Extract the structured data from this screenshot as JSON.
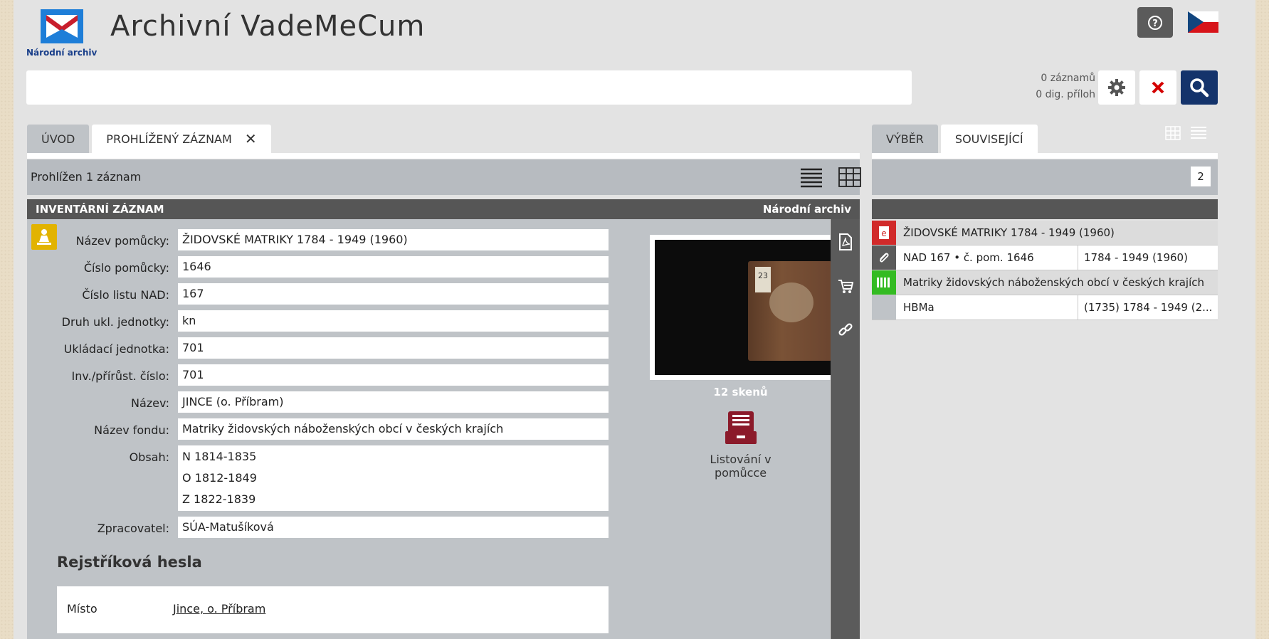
{
  "header": {
    "logo_text": "Národní archiv",
    "app_title": "Archivní VadeMeCum"
  },
  "search": {
    "records_count": "0 záznamů",
    "digital_count": "0 dig. příloh"
  },
  "left_tabs": [
    {
      "label": "ÚVOD"
    },
    {
      "label": "PROHLÍŽENÝ ZÁZNAM"
    }
  ],
  "right_tabs": [
    {
      "label": "VÝBĚR"
    },
    {
      "label": "SOUVISEJÍCÍ"
    }
  ],
  "left_panel": {
    "status": "Prohlížen 1 záznam"
  },
  "record": {
    "type_label": "INVENTÁRNÍ ZÁZNAM",
    "archive_label": "Národní archiv",
    "fields": [
      {
        "label": "Název pomůcky:",
        "value": "ŽIDOVSKÉ MATRIKY 1784 - 1949 (1960)"
      },
      {
        "label": "Číslo pomůcky:",
        "value": "1646"
      },
      {
        "label": "Číslo listu NAD:",
        "value": "167"
      },
      {
        "label": "Druh ukl. jednotky:",
        "value": "kn"
      },
      {
        "label": "Ukládací jednotka:",
        "value": "701"
      },
      {
        "label": "Inv./přírůst. číslo:",
        "value": "701"
      },
      {
        "label": "Název:",
        "value": "JINCE (o. Příbram)"
      },
      {
        "label": "Název fondu:",
        "value": "Matriky židovských náboženských obcí v českých krajích"
      },
      {
        "label": "Obsah:",
        "lines": [
          "N 1814-1835",
          "O 1812-1849",
          "Z 1822-1839"
        ]
      },
      {
        "label": "Zpracovatel:",
        "value": "SÚA-Matušíková"
      }
    ],
    "index_title": "Rejstříková hesla",
    "index_key": "Místo",
    "index_value": "Jince, o. Příbram",
    "scans_label": "12 skenů",
    "browse_label": "Listování v pomůcce",
    "book_tag": "23"
  },
  "right_panel": {
    "count": "2",
    "rows": [
      {
        "icon": "finding-aid-icon",
        "text": "ŽIDOVSKÉ MATRIKY 1784 - 1949 (1960)",
        "date": "",
        "color": "#d12a2a"
      },
      {
        "icon": "paperclip-icon",
        "text": "NAD 167 • č. pom. 1646",
        "date": "1784 - 1949 (1960)",
        "color": "#5b5b5b"
      },
      {
        "icon": "fund-icon",
        "text": "Matriky židovských náboženských obcí v českých krajích",
        "date": "",
        "color": "#33bb22"
      },
      {
        "icon": "",
        "text": "HBMa",
        "date": "(1735) 1784 - 1949 (2...",
        "color": ""
      }
    ]
  }
}
